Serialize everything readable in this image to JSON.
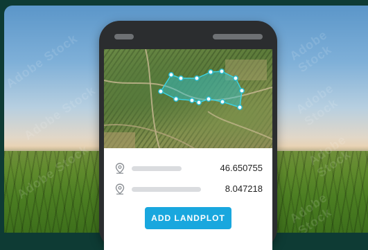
{
  "coordinates": {
    "latitude": "46.650755",
    "longitude": "8.047218"
  },
  "actions": {
    "add_landplot_label": "ADD LANDPLOT"
  },
  "icons": {
    "location": "location-pin-icon"
  },
  "watermark_text": "Adobe Stock",
  "colors": {
    "primary_button": "#19a7de",
    "polygon_stroke": "#3ad1e0",
    "polygon_fill": "#2fc7d8"
  }
}
